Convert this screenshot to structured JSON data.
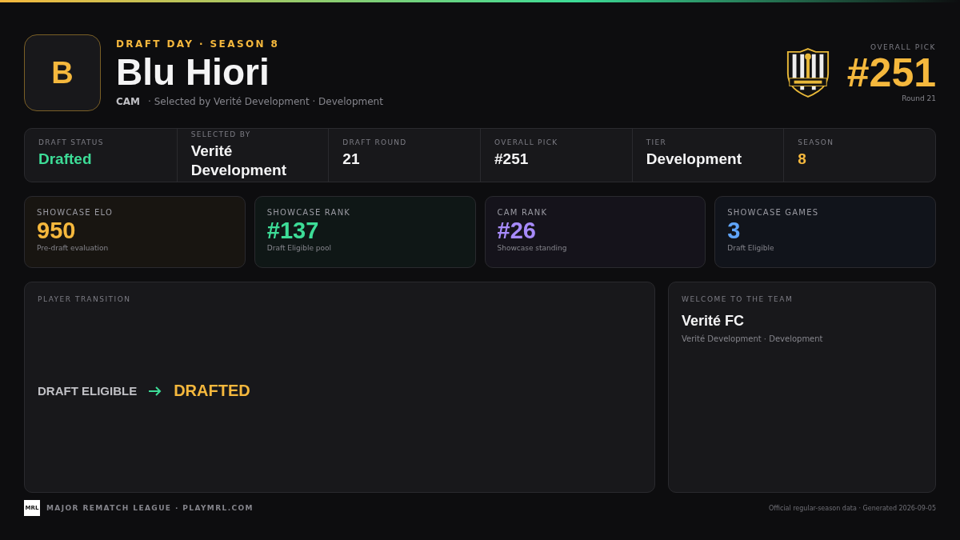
{
  "header": {
    "avatar_letter": "B",
    "eyebrow": "DRAFT DAY · SEASON 8",
    "name": "Blu Hiori",
    "position": "CAM",
    "subtitle": "· Selected by Verité Development · Development",
    "pick_label": "OVERALL PICK",
    "pick": "#251",
    "round": "Round 21"
  },
  "facts": [
    {
      "label": "DRAFT STATUS",
      "value": "Drafted",
      "color": "#3ddc97"
    },
    {
      "label": "SELECTED BY",
      "value": "Verité Development",
      "color": "#f4f4f5"
    },
    {
      "label": "DRAFT ROUND",
      "value": "21",
      "color": "#f4f4f5"
    },
    {
      "label": "OVERALL PICK",
      "value": "#251",
      "color": "#f4f4f5"
    },
    {
      "label": "TIER",
      "value": "Development",
      "color": "#f4f4f5"
    },
    {
      "label": "SEASON",
      "value": "8",
      "color": "#f5b83d"
    }
  ],
  "stats": [
    {
      "label": "SHOWCASE ELO",
      "value": "950",
      "note": "Pre-draft evaluation",
      "color": "#f5b83d"
    },
    {
      "label": "SHOWCASE RANK",
      "value": "#137",
      "note": "Draft Eligible pool",
      "color": "#3ddc97"
    },
    {
      "label": "CAM RANK",
      "value": "#26",
      "note": "Showcase standing",
      "color": "#a78bfa"
    },
    {
      "label": "SHOWCASE GAMES",
      "value": "3",
      "note": "Draft Eligible",
      "color": "#60a5fa"
    }
  ],
  "transition": {
    "title": "PLAYER TRANSITION",
    "from": "DRAFT ELIGIBLE",
    "to": "DRAFTED"
  },
  "welcome": {
    "title": "WELCOME TO THE TEAM",
    "team": "Verité FC",
    "detail": "Verité Development · Development"
  },
  "footer": {
    "logo": "MRL",
    "league": "MAJOR REMATCH LEAGUE · PLAYMRL.COM",
    "note": "Official regular-season data · Generated 2026-09-05"
  }
}
